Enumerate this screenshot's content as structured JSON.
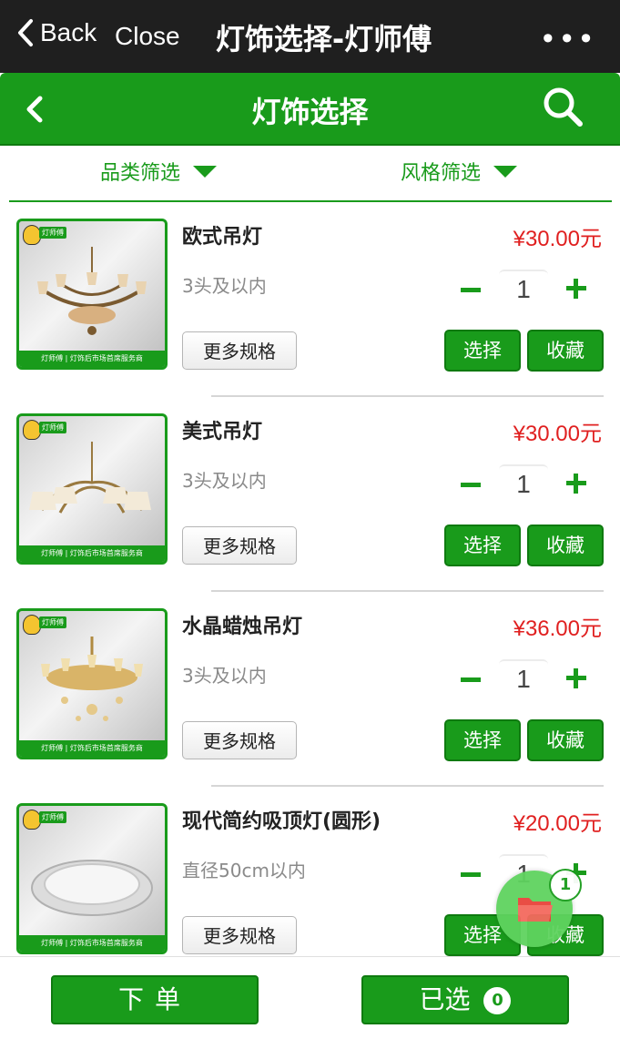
{
  "topbar": {
    "back_label": "Back",
    "close_label": "Close",
    "title": "灯饰选择-灯师傅",
    "more_label": "•••"
  },
  "header": {
    "title": "灯饰选择"
  },
  "filters": {
    "category": "品类筛选",
    "style": "风格筛选"
  },
  "thumb": {
    "logo_text": "灯师傅",
    "strip_text": "灯师傅 | 灯饰后市场首席服务商"
  },
  "products": [
    {
      "name": "欧式吊灯",
      "price": "¥30.00元",
      "spec": "3头及以内",
      "qty": "1",
      "more": "更多规格",
      "select": "选择",
      "favorite": "收藏"
    },
    {
      "name": "美式吊灯",
      "price": "¥30.00元",
      "spec": "3头及以内",
      "qty": "1",
      "more": "更多规格",
      "select": "选择",
      "favorite": "收藏"
    },
    {
      "name": "水晶蜡烛吊灯",
      "price": "¥36.00元",
      "spec": "3头及以内",
      "qty": "1",
      "more": "更多规格",
      "select": "选择",
      "favorite": "收藏"
    },
    {
      "name": "现代简约吸顶灯(圆形)",
      "price": "¥20.00元",
      "spec": "直径50cm以内",
      "qty": "1",
      "more": "更多规格",
      "select": "选择",
      "favorite": "收藏"
    }
  ],
  "cart_fab": {
    "count": "1",
    "icon": "folder-icon"
  },
  "bottom": {
    "order_label": "下单",
    "chosen_label": "已选",
    "chosen_count": "0"
  },
  "colors": {
    "green": "#199b1b",
    "price_red": "#e02020",
    "topbar": "#1f1f1f"
  }
}
